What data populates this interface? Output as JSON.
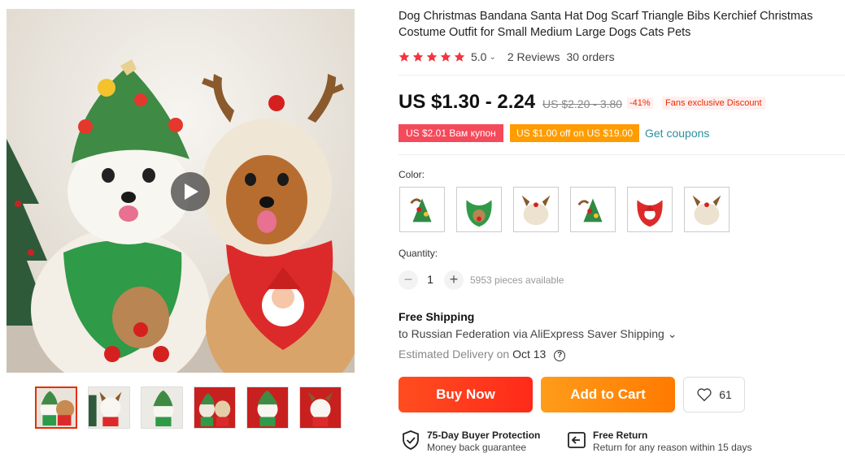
{
  "product": {
    "title": "Dog Christmas Bandana Santa Hat Dog Scarf Triangle Bibs Kerchief Christmas Costume Outfit for Small Medium Large Dogs Cats Pets",
    "rating": "5.0",
    "rating_caret": "⌄",
    "reviews": "2 Reviews",
    "orders": "30 orders",
    "star_color": "#f5343e"
  },
  "price": {
    "current": "US $1.30 - 2.24",
    "original": "US $2.20 - 3.80",
    "discount": "-41%",
    "fans_badge": "Fans exclusive Discount"
  },
  "coupons": {
    "coupon1": "US $2.01 Вам купон",
    "coupon2": "US $1.00 off on US $19.00",
    "get_coupons": "Get coupons"
  },
  "color": {
    "label": "Color:",
    "options": [
      "green-tree-bib-hat",
      "green-reindeer-bib",
      "beige-antler-hat",
      "green-tree-bib-hat-2",
      "red-santa-bib",
      "beige-antler-hat-2"
    ]
  },
  "quantity": {
    "label": "Quantity:",
    "minus": "−",
    "value": "1",
    "plus": "+",
    "available": "5953 pieces available"
  },
  "shipping": {
    "title": "Free Shipping",
    "detail": "to Russian Federation via AliExpress Saver Shipping ⌄",
    "estimated_label": "Estimated Delivery on",
    "estimated_date": "Oct 13",
    "help": "?"
  },
  "actions": {
    "buy_now": "Buy Now",
    "add_to_cart": "Add to Cart",
    "wishlist_count": "61"
  },
  "guarantees": {
    "protection_title": "75-Day Buyer Protection",
    "protection_sub": "Money back guarantee",
    "return_title": "Free Return",
    "return_sub": "Return for any reason within 15 days"
  },
  "colors": {
    "accent_red": "#e62e04",
    "buy_now": "#ff3b1f",
    "add_to_cart": "#ff8a00",
    "coupon_red": "#f44a5b",
    "coupon_orange": "#ff9c00",
    "link_teal": "#2d8e9c"
  }
}
